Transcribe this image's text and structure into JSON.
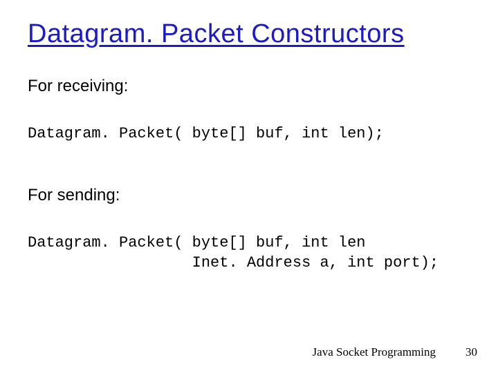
{
  "title": "Datagram. Packet Constructors",
  "section_receiving": "For receiving:",
  "code_receiving": "Datagram. Packet( byte[] buf, int len);",
  "section_sending": "For sending:",
  "code_sending": "Datagram. Packet( byte[] buf, int len\n                  Inet. Address a, int port);",
  "footer": "Java Socket Programming",
  "page": "30"
}
